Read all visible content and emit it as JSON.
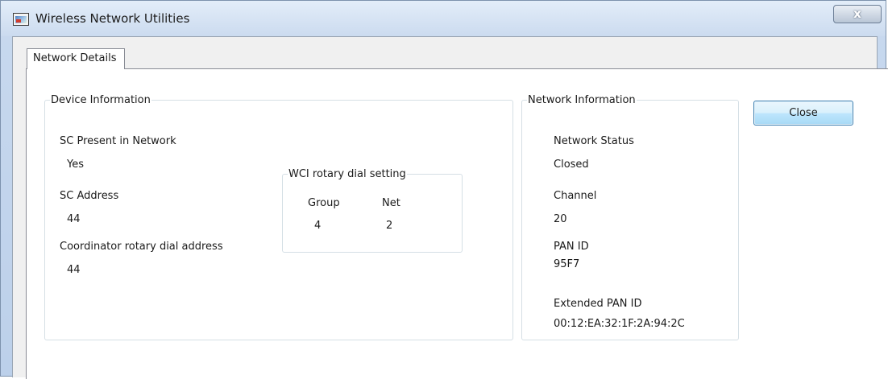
{
  "window": {
    "title": "Wireless Network Utilities",
    "close_glyph": "x"
  },
  "tabs": [
    {
      "label": "Network Details"
    }
  ],
  "device_info": {
    "legend": "Device Information",
    "sc_present_label": "SC Present in Network",
    "sc_present_value": "Yes",
    "sc_address_label": "SC Address",
    "sc_address_value": "44",
    "coordinator_label": "Coordinator rotary dial address",
    "coordinator_value": "44"
  },
  "wci_rotary": {
    "legend": "WCI rotary dial setting",
    "group_label": "Group",
    "group_value": "4",
    "net_label": "Net",
    "net_value": "2"
  },
  "network_info": {
    "legend": "Network Information",
    "status_label": "Network Status",
    "status_value": "Closed",
    "channel_label": "Channel",
    "channel_value": "20",
    "pan_id_label": "PAN ID",
    "pan_id_value": "95F7",
    "ext_pan_id_label": "Extended PAN ID",
    "ext_pan_id_value": "00:12:EA:32:1F:2A:94:2C"
  },
  "buttons": {
    "close_label": "Close"
  },
  "icons": {
    "app": "network-utility-icon",
    "window_close": "close-icon"
  }
}
